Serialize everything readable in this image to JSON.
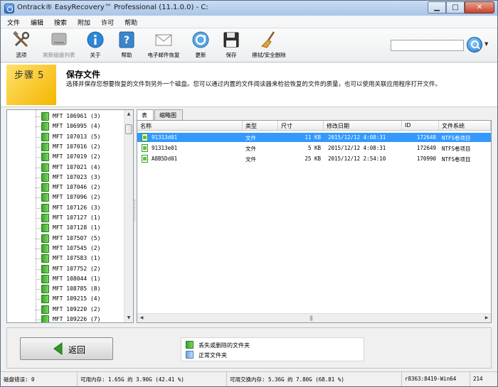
{
  "window": {
    "title": "Ontrack® EasyRecovery™ Professional (11.1.0.0) - C:",
    "minimize": "▁",
    "maximize": "□",
    "close": "✕"
  },
  "menu": [
    "文件",
    "编辑",
    "搜索",
    "附加",
    "许可",
    "帮助"
  ],
  "toolbar": [
    {
      "label": "选项",
      "icon": "tools-icon",
      "enabled": true
    },
    {
      "label": "刷新磁盘列表",
      "icon": "disk-icon",
      "enabled": false
    },
    {
      "label": "关于",
      "icon": "info-icon",
      "enabled": true
    },
    {
      "label": "帮助",
      "icon": "help-icon",
      "enabled": true
    },
    {
      "label": "电子邮件恢复",
      "icon": "envelope-icon",
      "enabled": true
    },
    {
      "label": "更新",
      "icon": "update-icon",
      "enabled": true
    },
    {
      "label": "保存",
      "icon": "floppy-icon",
      "enabled": true
    },
    {
      "label": "擦拭/安全删除",
      "icon": "broom-icon",
      "enabled": true
    }
  ],
  "search": {
    "value": "",
    "placeholder": ""
  },
  "step": {
    "badge": "步骤 5",
    "title": "保存文件",
    "description": "选择并保存您想要恢复的文件到另外一个磁盘。您可以通过内置的文件阅读器来检验恢复的文件的质量，也可以使用关联应用程序打开文件。"
  },
  "tree": [
    {
      "name": "MFT 106961",
      "count": "(3)"
    },
    {
      "name": "MFT 106995",
      "count": "(4)"
    },
    {
      "name": "MFT 107013",
      "count": "(5)"
    },
    {
      "name": "MFT 107016",
      "count": "(2)"
    },
    {
      "name": "MFT 107019",
      "count": "(2)"
    },
    {
      "name": "MFT 107021",
      "count": "(4)"
    },
    {
      "name": "MFT 107023",
      "count": "(3)"
    },
    {
      "name": "MFT 107046",
      "count": "(2)"
    },
    {
      "name": "MFT 107096",
      "count": "(2)"
    },
    {
      "name": "MFT 107126",
      "count": "(3)"
    },
    {
      "name": "MFT 107127",
      "count": "(1)"
    },
    {
      "name": "MFT 107128",
      "count": "(1)"
    },
    {
      "name": "MFT 107507",
      "count": "(5)"
    },
    {
      "name": "MFT 107545",
      "count": "(2)"
    },
    {
      "name": "MFT 107583",
      "count": "(1)"
    },
    {
      "name": "MFT 107752",
      "count": "(2)"
    },
    {
      "name": "MFT 108044",
      "count": "(1)"
    },
    {
      "name": "MFT 108785",
      "count": "(8)"
    },
    {
      "name": "MFT 109215",
      "count": "(4)"
    },
    {
      "name": "MFT 109220",
      "count": "(2)"
    },
    {
      "name": "MFT 109226",
      "count": "(7)"
    }
  ],
  "tabs": [
    "表",
    "缩略图"
  ],
  "columns": [
    "名称",
    "类型",
    "尺寸",
    "修改日期",
    "ID",
    "文件系统"
  ],
  "files": [
    {
      "name": "91313d01",
      "type": "文件",
      "size": "11 KB",
      "modified": "2015/12/12 4:08:31",
      "id": "172648",
      "fs": "NTFS卷项目",
      "selected": true
    },
    {
      "name": "91313e01",
      "type": "文件",
      "size": "5 KB",
      "modified": "2015/12/12 4:08:31",
      "id": "172649",
      "fs": "NTFS卷项目",
      "selected": false
    },
    {
      "name": "A8B5Dd01",
      "type": "文件",
      "size": "25 KB",
      "modified": "2015/12/12 2:54:10",
      "id": "170990",
      "fs": "NTFS卷项目",
      "selected": false
    }
  ],
  "bottom": {
    "back_label": "返回",
    "legend": [
      {
        "label": "丢失或删除的文件夹",
        "color": "green"
      },
      {
        "label": "正常文件夹",
        "color": "blue"
      }
    ]
  },
  "status": {
    "disk_errors": "磁盘错误: 0",
    "memory": "可用内存: 1.65G 的 3.90G (42.41 %)",
    "swap": "可用交换内存: 5.36G 的 7.80G (68.81 %)",
    "build": "r8363:8419-Win64",
    "code": "214"
  },
  "colors": {
    "selection": "#3399ff",
    "step_badge": "#f4b600",
    "deleted_folder": "#3aa52d"
  }
}
